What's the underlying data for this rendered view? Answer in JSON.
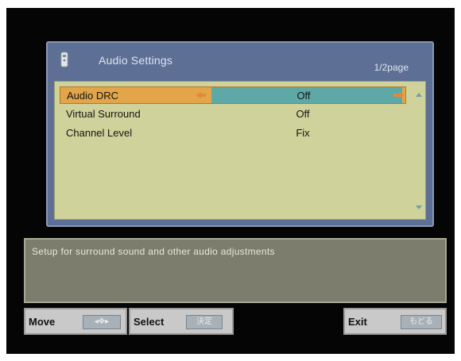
{
  "menu": {
    "title": "Audio Settings",
    "page_indicator": "1/2page",
    "items": [
      {
        "label": "Audio DRC",
        "value": "Off",
        "selected": true
      },
      {
        "label": "Virtual Surround",
        "value": "Off",
        "selected": false
      },
      {
        "label": "Channel Level",
        "value": "Fix",
        "selected": false
      }
    ]
  },
  "description": "Setup for surround sound and other audio adjustments",
  "controls": {
    "move_label": "Move",
    "move_key": "◂✥▸",
    "select_label": "Select",
    "select_key": "決定",
    "exit_label": "Exit",
    "exit_key": "もどる"
  },
  "colors": {
    "panel": "#5d6f94",
    "list_bg": "#cfd29a",
    "selected_row": "#e2a54a",
    "value_bar": "#5fa8a8",
    "description_bg": "#7d7d6e"
  }
}
